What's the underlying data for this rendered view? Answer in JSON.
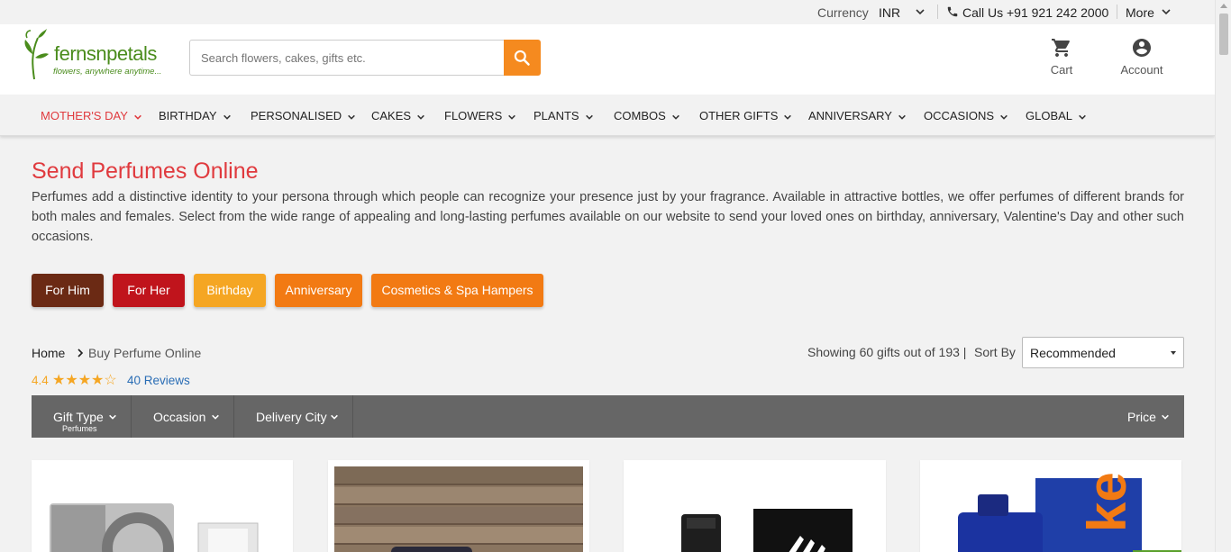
{
  "topbar": {
    "currency_label": "Currency",
    "currency_value": "INR",
    "call_text": "Call Us +91 921 242 2000",
    "more_label": "More"
  },
  "header": {
    "logo_text": "fernsnpetals",
    "logo_tagline": "flowers, anywhere anytime...",
    "search_placeholder": "Search flowers, cakes, gifts etc.",
    "cart_label": "Cart",
    "account_label": "Account"
  },
  "nav": {
    "items": [
      {
        "label": "MOTHER'S DAY"
      },
      {
        "label": "BIRTHDAY"
      },
      {
        "label": "PERSONALISED"
      },
      {
        "label": "CAKES"
      },
      {
        "label": "FLOWERS"
      },
      {
        "label": "PLANTS"
      },
      {
        "label": "COMBOS"
      },
      {
        "label": "OTHER GIFTS"
      },
      {
        "label": "ANNIVERSARY"
      },
      {
        "label": "OCCASIONS"
      },
      {
        "label": "GLOBAL"
      }
    ]
  },
  "main": {
    "title": "Send Perfumes Online",
    "description": "Perfumes add a distinctive identity to your persona through which people can recognize your presence just by your fragrance. Available in attractive bottles, we offer perfumes of different brands for both males and females. Select from the wide range of appealing and long-lasting perfumes available on our website to send your loved ones on birthday, anniversary, Valentine's Day and other such occasions.",
    "chips": [
      {
        "label": "For Him",
        "color": "#6b2a14"
      },
      {
        "label": "For Her",
        "color": "#c0141c"
      },
      {
        "label": "Birthday",
        "color": "#f5a623"
      },
      {
        "label": "Anniversary",
        "color": "#f27a13"
      },
      {
        "label": "Cosmetics & Spa Hampers",
        "color": "#f27a13"
      }
    ],
    "breadcrumb": {
      "home": "Home",
      "current": "Buy Perfume Online"
    },
    "showing": "Showing 60 gifts out of 193 |",
    "sort_by_label": "Sort By",
    "sort_value": "Recommended",
    "rating": "4.4",
    "stars": "★★★★☆",
    "reviews": "40  Reviews"
  },
  "filters": {
    "gift_type": "Gift Type",
    "gift_type_sub": "Perfumes",
    "occasion": "Occasion",
    "delivery_city": "Delivery City",
    "price": "Price"
  },
  "colors": {
    "accent": "#e03a3e",
    "search_button": "#f58a1f",
    "filter_bar": "#666666",
    "logo_green": "#4a8c1c"
  }
}
